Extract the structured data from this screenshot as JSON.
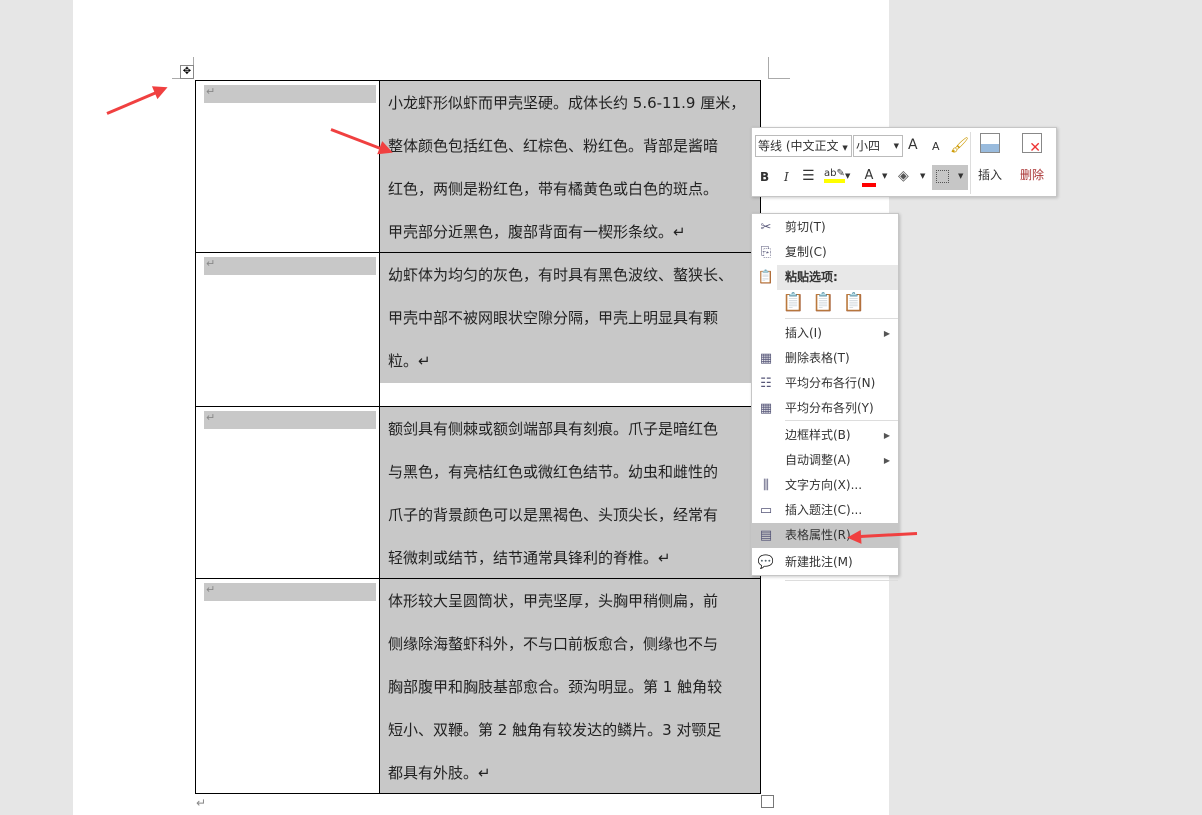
{
  "table": {
    "rows": [
      {
        "lines": [
          "小龙虾形似虾而甲壳坚硬。成体长约 5.6-11.9 厘米，",
          "整体颜色包括红色、红棕色、粉红色。背部是酱暗",
          "红色，两侧是粉红色，带有橘黄色或白色的斑点。",
          "甲壳部分近黑色，腹部背面有一楔形条纹。↵"
        ]
      },
      {
        "lines": [
          "幼虾体为均匀的灰色，有时具有黑色波纹、螯狭长、",
          "甲壳中部不被网眼状空隙分隔，甲壳上明显具有颗",
          "粒。↵"
        ]
      },
      {
        "lines": [
          "额剑具有侧棘或额剑端部具有刻痕。爪子是暗红色",
          "与黑色，有亮桔红色或微红色结节。幼虫和雌性的",
          "爪子的背景颜色可以是黑褐色、头顶尖长，经常有",
          "轻微刺或结节，结节通常具锋利的脊椎。↵"
        ]
      },
      {
        "lines": [
          "体形较大呈圆筒状，甲壳坚厚，头胸甲稍侧扁，前",
          "侧缘除海螯虾科外，不与口前板愈合，侧缘也不与",
          "胸部腹甲和胸肢基部愈合。颈沟明显。第 1 触角较",
          "短小、双鞭。第 2 触角有较发达的鳞片。3 对颚足",
          "都具有外肢。↵"
        ]
      }
    ],
    "para_mark": "↵"
  },
  "mini_toolbar": {
    "font": "等线 (中文正文",
    "size": "小四",
    "bold": "B",
    "italic": "I",
    "insert": "插入",
    "delete": "删除",
    "grow": "A",
    "shrink": "A",
    "font_color": "A"
  },
  "context_menu": {
    "items": [
      {
        "label": "剪切(T)",
        "icon": "scissors-icon"
      },
      {
        "label": "复制(C)",
        "icon": "copy-icon"
      },
      {
        "label": "粘贴选项:",
        "icon": "paste-icon"
      },
      {
        "label": "插入(I)",
        "icon": ""
      },
      {
        "label": "删除表格(T)",
        "icon": "delete-table-icon"
      },
      {
        "label": "平均分布各行(N)",
        "icon": "distribute-rows-icon"
      },
      {
        "label": "平均分布各列(Y)",
        "icon": "distribute-columns-icon"
      },
      {
        "label": "边框样式(B)",
        "icon": ""
      },
      {
        "label": "自动调整(A)",
        "icon": ""
      },
      {
        "label": "文字方向(X)...",
        "icon": "text-direction-icon"
      },
      {
        "label": "插入题注(C)...",
        "icon": "caption-icon"
      },
      {
        "label": "表格属性(R)...",
        "icon": "table-properties-icon"
      },
      {
        "label": "新建批注(M)",
        "icon": "comment-icon"
      }
    ]
  },
  "colors": {
    "selection": "#c8c8c8",
    "arrow": "#f04040",
    "highlight": "#ffff00",
    "font_color": "#ff0000"
  }
}
